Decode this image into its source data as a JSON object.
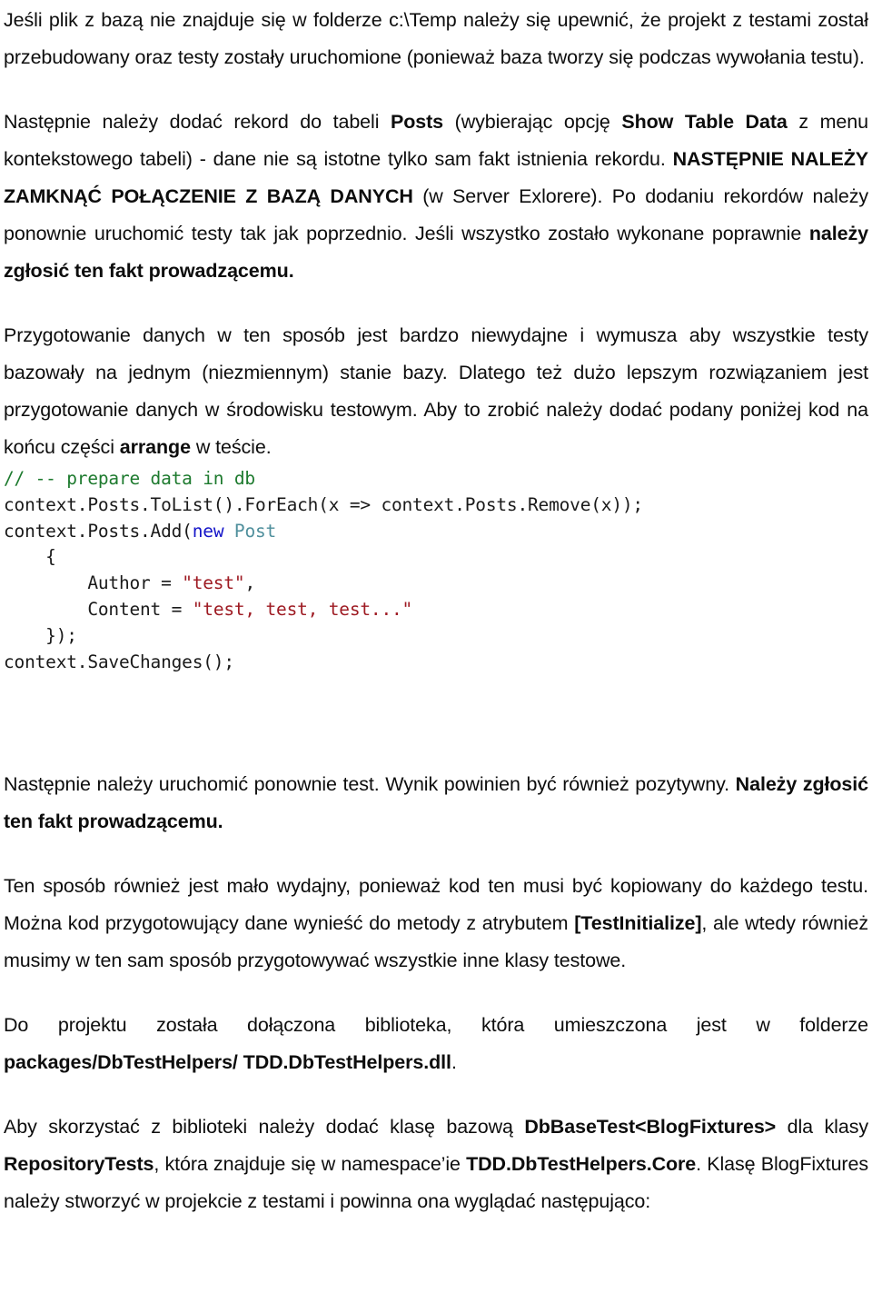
{
  "document": {
    "language": "pl",
    "paragraphs": [
      {
        "id": "p1",
        "name": "paragraph-db-file-location",
        "runs": [
          {
            "text": "Jeśli plik z bazą nie znajduje się w folderze c:\\Temp należy się upewnić, że projekt z testami został przebudowany oraz testy zostały uruchomione (ponieważ baza tworzy się podczas wywołania testu).",
            "bold": false
          }
        ]
      },
      {
        "id": "p2",
        "name": "paragraph-add-record-posts",
        "runs": [
          {
            "text": "Następnie należy dodać rekord do tabeli ",
            "bold": false
          },
          {
            "text": "Posts",
            "bold": true
          },
          {
            "text": " (wybierając opcję ",
            "bold": false
          },
          {
            "text": "Show Table Data",
            "bold": true
          },
          {
            "text": " z menu kontekstowego tabeli)  - dane nie są istotne tylko sam fakt istnienia rekordu. ",
            "bold": false
          },
          {
            "text": "NASTĘPNIE NALEŻY ZAMKNĄĆ POŁĄCZENIE Z BAZĄ DANYCH",
            "bold": true
          },
          {
            "text": " (w Server Exlorere). Po dodaniu rekordów należy ponownie uruchomić testy tak jak poprzednio. Jeśli wszystko zostało wykonane poprawnie ",
            "bold": false
          },
          {
            "text": "należy zgłosić ten fakt prowadzącemu.",
            "bold": true
          }
        ]
      },
      {
        "id": "p3",
        "name": "paragraph-data-preparation-inefficient",
        "runs": [
          {
            "text": "Przygotowanie danych w ten sposób jest bardzo niewydajne i wymusza aby wszystkie testy bazowały na jednym (niezmiennym) stanie bazy. Dlatego też dużo lepszym rozwiązaniem jest przygotowanie danych w środowisku testowym. Aby to zrobić należy dodać podany poniżej kod na końcu części ",
            "bold": false
          },
          {
            "text": "arrange",
            "bold": true
          },
          {
            "text": " w teście.",
            "bold": false
          }
        ]
      }
    ],
    "code_block": {
      "name": "code-sample-prepare-data",
      "language": "csharp",
      "lines": [
        [
          {
            "text": "// -- prepare data in db",
            "token": "comment"
          }
        ],
        [
          {
            "text": "context.Posts.ToList().ForEach(x => context.Posts.Remove(x));",
            "token": "plain"
          }
        ],
        [
          {
            "text": "context.Posts.Add(",
            "token": "plain"
          },
          {
            "text": "new",
            "token": "keyword"
          },
          {
            "text": " ",
            "token": "plain"
          },
          {
            "text": "Post",
            "token": "type"
          }
        ],
        [
          {
            "text": "    {",
            "token": "plain"
          }
        ],
        [
          {
            "text": "        Author = ",
            "token": "plain"
          },
          {
            "text": "\"test\"",
            "token": "string"
          },
          {
            "text": ",",
            "token": "plain"
          }
        ],
        [
          {
            "text": "        Content = ",
            "token": "plain"
          },
          {
            "text": "\"test, test, test...\"",
            "token": "string"
          }
        ],
        [
          {
            "text": "    });",
            "token": "plain"
          }
        ],
        [
          {
            "text": "context.SaveChanges();",
            "token": "plain"
          }
        ]
      ]
    },
    "paragraphs_after_code": [
      {
        "id": "p4",
        "name": "paragraph-rerun-test-result",
        "runs": [
          {
            "text": "Następnie należy uruchomić ponownie test. Wynik powinien być również pozytywny. ",
            "bold": false
          },
          {
            "text": "Należy zgłosić ten fakt prowadzącemu.",
            "bold": true
          }
        ]
      },
      {
        "id": "p5",
        "name": "paragraph-testinitialize-attribute",
        "runs": [
          {
            "text": "Ten sposób również jest mało wydajny, ponieważ kod ten musi być kopiowany do każdego testu. Można kod przygotowujący dane wynieść do metody z atrybutem ",
            "bold": false
          },
          {
            "text": "[TestInitialize]",
            "bold": true
          },
          {
            "text": ", ale wtedy również musimy w ten sam sposób przygotowywać wszystkie inne klasy testowe.",
            "bold": false
          }
        ]
      },
      {
        "id": "p6",
        "name": "paragraph-library-location",
        "runs": [
          {
            "text": "Do projektu została dołączona biblioteka, która umieszczona jest w folderze ",
            "bold": false
          },
          {
            "text": "packages/DbTestHelpers/ TDD.DbTestHelpers.dll",
            "bold": true
          },
          {
            "text": ".",
            "bold": false
          }
        ]
      },
      {
        "id": "p7",
        "name": "paragraph-dbbasetest-usage",
        "runs": [
          {
            "text": "Aby skorzystać z biblioteki należy dodać klasę bazową ",
            "bold": false
          },
          {
            "text": "DbBaseTest<BlogFixtures>",
            "bold": true
          },
          {
            "text": " dla klasy ",
            "bold": false
          },
          {
            "text": "RepositoryTests",
            "bold": true
          },
          {
            "text": ", która znajduje się w namespace’ie ",
            "bold": false
          },
          {
            "text": "TDD.DbTestHelpers.Core",
            "bold": true
          },
          {
            "text": ". Klasę BlogFixtures należy stworzyć w projekcie z testami i powinna ona wyglądać następująco:",
            "bold": false
          }
        ]
      }
    ]
  },
  "colors": {
    "text": "#0d0d0d",
    "code_plain": "#1a1a1a",
    "code_comment": "#1d7a2e",
    "code_keyword": "#1414c8",
    "code_type": "#4f8f9c",
    "code_string": "#9e1b23",
    "page_background": "#ffffff"
  }
}
